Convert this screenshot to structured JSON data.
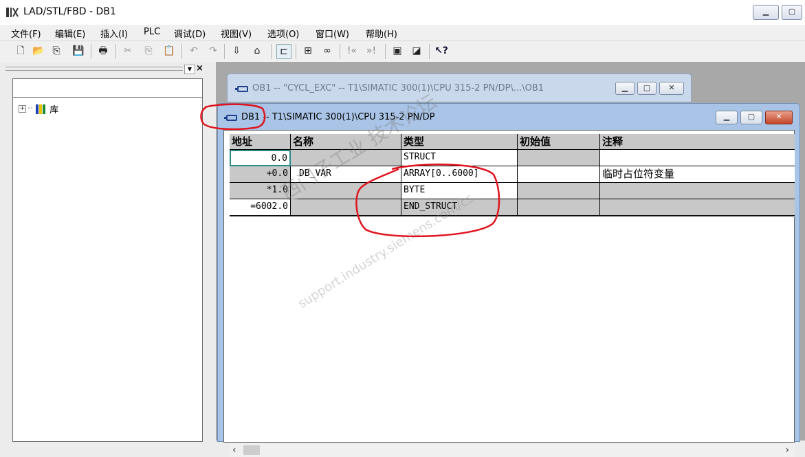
{
  "app": {
    "title": "LAD/STL/FBD  - DB1"
  },
  "menu": [
    "文件(F)",
    "编辑(E)",
    "插入(I)",
    "PLC",
    "调试(D)",
    "视图(V)",
    "选项(O)",
    "窗口(W)",
    "帮助(H)"
  ],
  "left_panel": {
    "tree_root": "库"
  },
  "ob1_window": {
    "title": "OB1 -- \"CYCL_EXC\" -- T1\\SIMATIC 300(1)\\CPU 315-2 PN/DP\\...\\OB1"
  },
  "db1_window": {
    "title_db": "DB1",
    "title_rest": " -- T1\\SIMATIC 300(1)\\CPU 315-2 PN/DP"
  },
  "table": {
    "headers": [
      "地址",
      "名称",
      "类型",
      "初始值",
      "注释"
    ],
    "rows": [
      {
        "address": "0.0",
        "name": "",
        "type": "STRUCT",
        "initial": "",
        "comment": ""
      },
      {
        "address": "+0.0",
        "name": "DB_VAR",
        "type": "ARRAY[0..6000]",
        "initial": "",
        "comment": "临时占位符变量"
      },
      {
        "address": "*1.0",
        "name": "",
        "type": "BYTE",
        "initial": "",
        "comment": ""
      },
      {
        "address": "=6002.0",
        "name": "",
        "type": "END_STRUCT",
        "initial": "",
        "comment": ""
      }
    ]
  },
  "watermark": {
    "line1": "西门子工业 技术论坛",
    "line2": "support.industry.siemens.com/cs"
  },
  "colors": {
    "annotation": "#e0141e",
    "selected_cell_border": "#2a8a8a",
    "title_active": "#a9c4e6"
  }
}
